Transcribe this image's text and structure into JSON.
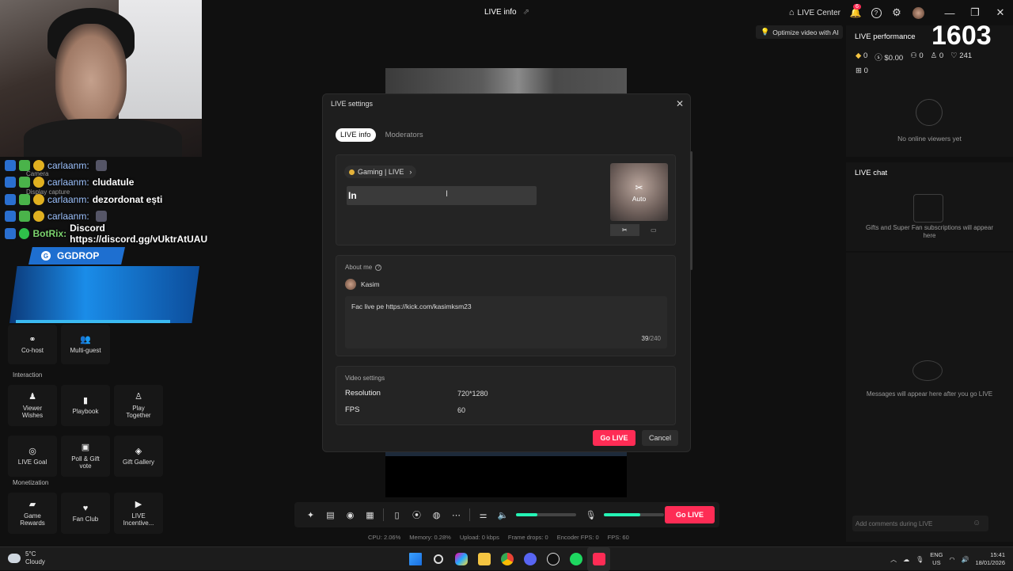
{
  "window": {
    "title": "LIVE info",
    "live_center": "LIVE Center",
    "notification_count": "6",
    "optimize_tip": "Optimize video with AI"
  },
  "overlay": {
    "chat": [
      {
        "user": "carlaanm:",
        "text": ""
      },
      {
        "user": "carlaanm:",
        "text": "cludatule"
      },
      {
        "user": "carlaanm:",
        "text": "dezordonat ești"
      },
      {
        "user": "carlaanm:",
        "text": ""
      },
      {
        "user": "BotRix:",
        "text": "Discord https://discord.gg/vUktrAtUAU"
      }
    ],
    "camera_label": "Camera",
    "display_capture_label": "Display capture",
    "ggdrop": "GGDROP"
  },
  "left_tools": {
    "top": [
      {
        "label": "Co-host",
        "icon": "link-icon"
      },
      {
        "label": "Multi-guest",
        "icon": "people-icon"
      }
    ],
    "interaction_label": "Interaction",
    "interaction": [
      {
        "label": "Viewer Wishes",
        "icon": "wishes-icon"
      },
      {
        "label": "Playbook",
        "icon": "playbook-icon"
      },
      {
        "label": "Play Together",
        "icon": "play-together-icon"
      },
      {
        "label": "LIVE Goal",
        "icon": "goal-icon"
      },
      {
        "label": "Poll & Gift vote",
        "icon": "poll-icon"
      },
      {
        "label": "Gift Gallery",
        "icon": "gift-gallery-icon"
      }
    ],
    "monetization_label": "Monetization",
    "monetization": [
      {
        "label": "Game Rewards",
        "icon": "rewards-icon"
      },
      {
        "label": "Fan Club",
        "icon": "heart-icon"
      },
      {
        "label": "LIVE Incentive...",
        "icon": "video-icon"
      }
    ]
  },
  "modal": {
    "title": "LIVE settings",
    "tabs": [
      "LIVE info",
      "Moderators"
    ],
    "topic": "Gaming | LIVE",
    "title_value": "In",
    "cover_label": "Auto",
    "about_label": "About me",
    "user_name": "Kasim",
    "bio": "Fac live pe https://kick.com/kasimksm23",
    "bio_count": "39",
    "bio_max": "/240",
    "video_label": "Video settings",
    "resolution_label": "Resolution",
    "resolution_value": "720*1280",
    "fps_label": "FPS",
    "fps_value": "60",
    "go_live": "Go LIVE",
    "cancel": "Cancel"
  },
  "bottom": {
    "go_live": "Go LIVE",
    "volume_level": 0.35,
    "mic_level": 0.6,
    "stats": {
      "cpu": "CPU: 2.06%",
      "memory": "Memory: 0.28%",
      "upload": "Upload: 0 kbps",
      "frame_drops": "Frame drops: 0",
      "encoder_fps": "Encoder FPS: 0",
      "fps": "FPS: 60"
    }
  },
  "right": {
    "perf_title": "LIVE performance",
    "viewers": "1603",
    "diamonds": "0",
    "earnings": "$0.00",
    "new_followers": "0",
    "shares": "0",
    "likes": "241",
    "gifters": "0",
    "no_viewers": "No online viewers yet",
    "chat_title": "LIVE chat",
    "gift_text": "Gifts and Super Fan subscriptions will appear here",
    "chat_empty": "Messages will appear here after you go LIVE",
    "comment_placeholder": "Add comments during LIVE"
  },
  "taskbar": {
    "temp": "5°C",
    "weather": "Cloudy",
    "lang1": "ENG",
    "lang2": "US",
    "time": "15:41",
    "date": "18/01/2026"
  },
  "colors": {
    "accent": "#fe2c55",
    "mint": "#25f4b5"
  }
}
